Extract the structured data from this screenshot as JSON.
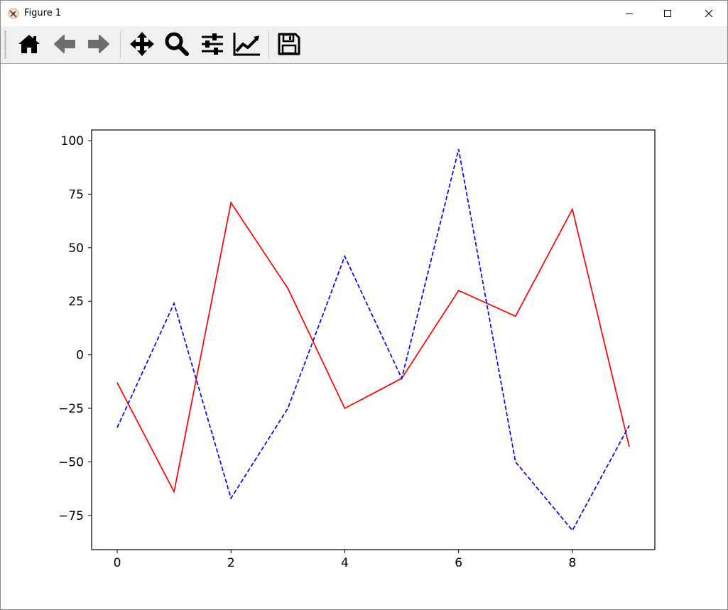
{
  "window": {
    "title": "Figure 1",
    "controls": [
      "minimize",
      "maximize",
      "close"
    ]
  },
  "toolbar": {
    "buttons": [
      {
        "name": "home",
        "icon": "home-icon"
      },
      {
        "name": "back",
        "icon": "arrow-left-icon"
      },
      {
        "name": "forward",
        "icon": "arrow-right-icon"
      },
      {
        "name": "pan",
        "icon": "move-arrows-icon"
      },
      {
        "name": "zoom",
        "icon": "magnifier-icon"
      },
      {
        "name": "configure-subplots",
        "icon": "sliders-icon"
      },
      {
        "name": "edit-axis",
        "icon": "line-chart-icon"
      },
      {
        "name": "save",
        "icon": "floppy-disk-icon"
      }
    ]
  },
  "chart_data": {
    "type": "line",
    "title": "",
    "xlabel": "",
    "ylabel": "",
    "xlim": [
      -0.45,
      9.45
    ],
    "ylim": [
      -91,
      105
    ],
    "grid": false,
    "xticks": [
      0,
      2,
      4,
      6,
      8
    ],
    "xtick_labels": [
      "0",
      "2",
      "4",
      "6",
      "8"
    ],
    "yticks": [
      100,
      75,
      50,
      25,
      0,
      -25,
      -50,
      -75
    ],
    "ytick_labels": [
      "100",
      "75",
      "50",
      "25",
      "0",
      "−25",
      "−50",
      "−75"
    ],
    "x": [
      0,
      1,
      2,
      3,
      4,
      5,
      6,
      7,
      8,
      9
    ],
    "series": [
      {
        "color": "#ff0000",
        "linestyle": "solid",
        "values": [
          -13,
          -64,
          71,
          31,
          -25,
          -11,
          30,
          18,
          68,
          -43
        ]
      },
      {
        "color": "#0000ff",
        "linestyle": "dashed",
        "values": [
          -34,
          24,
          -67,
          -25,
          46,
          -11,
          96,
          -50,
          -82,
          -33
        ]
      }
    ]
  }
}
